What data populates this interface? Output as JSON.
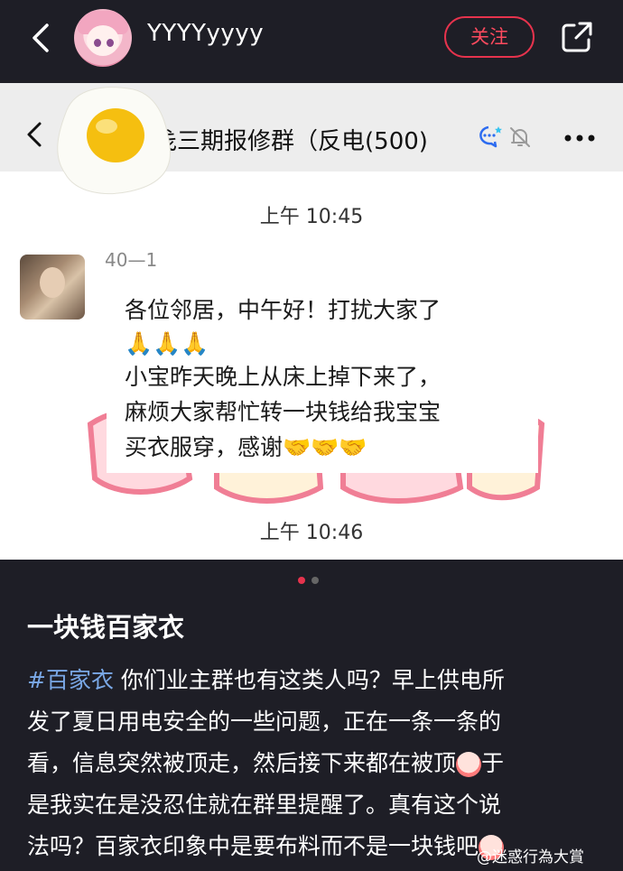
{
  "topbar": {
    "username": "YYYYyyyy",
    "follow_label": "关注"
  },
  "chat": {
    "group_title": "戋三期报修群（反电",
    "member_count": "(500)",
    "time_first": "上午 10:45",
    "sender_name": "40—1",
    "message_lines": [
      "各位邻居，中午好！打扰大家了",
      "🙏🙏🙏",
      " 小宝昨天晚上从床上掉下来了，",
      "麻烦大家帮忙转一块钱给我宝宝",
      "买衣服穿，感谢🤝🤝🤝"
    ],
    "time_second": "上午 10:46"
  },
  "pager": {
    "current": 1,
    "total": 2,
    "active_color": "#e6334d",
    "inactive_color": "#666666"
  },
  "post": {
    "title": "一块钱百家衣",
    "hashtag": "#百家衣",
    "lines": [
      " 你们业主群也有这类人吗？早上供电所",
      "发了夏日用电安全的一些问题，正在一条一条的",
      "看，信息突然被顶走，然后接下来都在被顶",
      "是我实在是没忍住就在群里提醒了。真有这个说",
      "法吗？百家衣印象中是要布料而不是一块钱吧"
    ],
    "line3_tail": "于",
    "watermark": "@迷惑行為大賞"
  },
  "icons": {
    "back": "back-arrow-icon",
    "share": "share-icon",
    "chat_back": "chevron-left-icon",
    "group": "group-chat-icon",
    "mute": "bell-muted-icon",
    "more": "more-icon",
    "egg": "fried-egg-sticker"
  }
}
